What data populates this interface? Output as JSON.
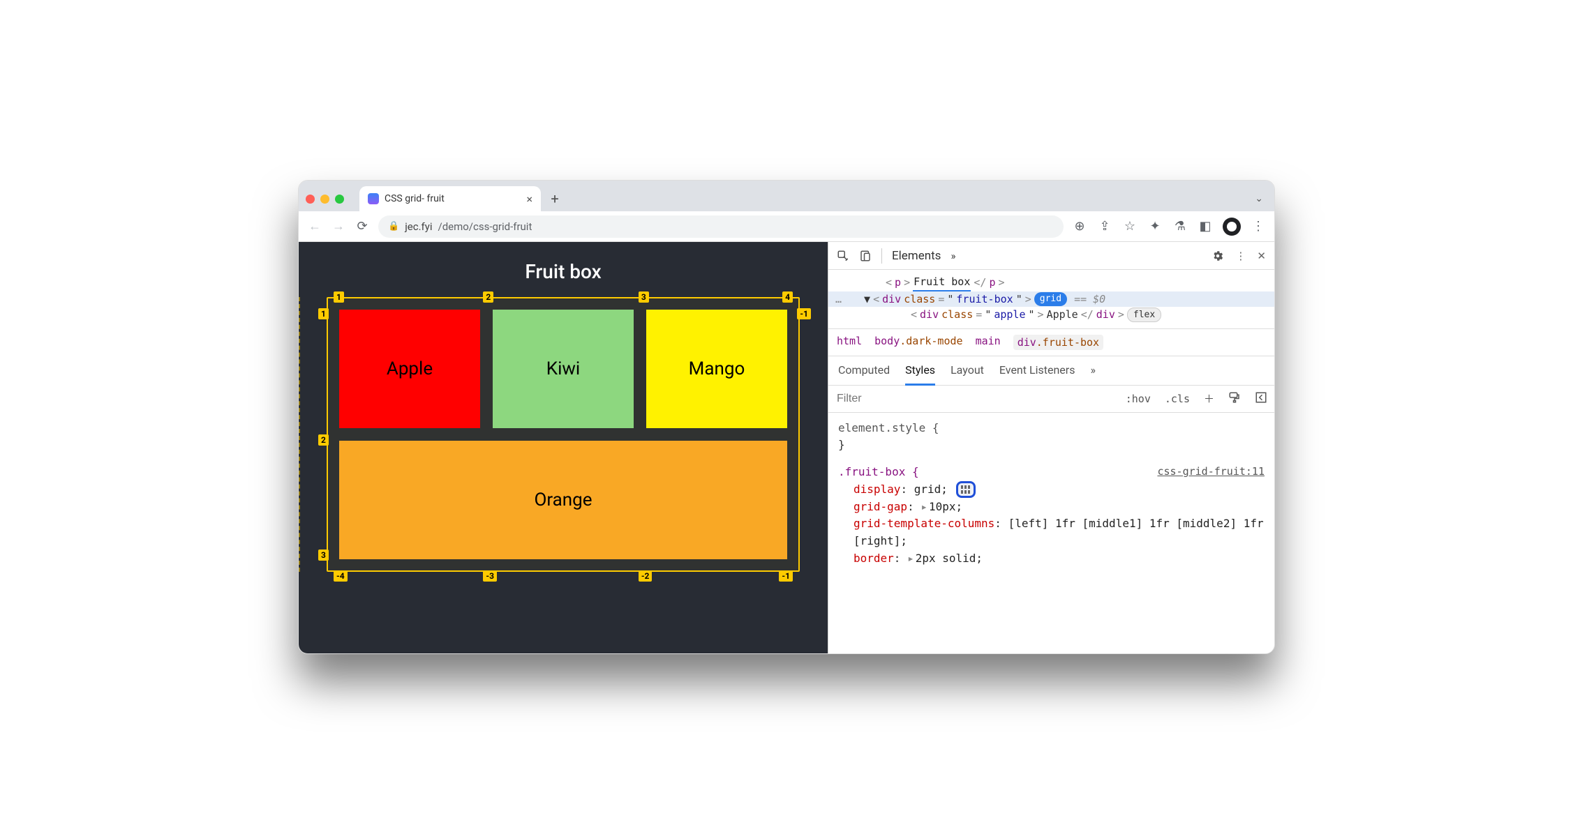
{
  "browser": {
    "tab_title": "CSS grid- fruit",
    "url_host": "jec.fyi",
    "url_path": "/demo/css-grid-fruit"
  },
  "page": {
    "title": "Fruit box",
    "fruits": {
      "apple": "Apple",
      "kiwi": "Kiwi",
      "mango": "Mango",
      "orange": "Orange"
    },
    "col_labels_top": [
      "1",
      "2",
      "3",
      "4"
    ],
    "row_labels_left": [
      "1",
      "2",
      "3"
    ],
    "neg_label_right": "-1",
    "neg_labels_bottom": [
      "-4",
      "-3",
      "-2",
      "-1"
    ]
  },
  "devtools": {
    "panel": "Elements",
    "dom": {
      "p_text": "Fruit box",
      "div_class": "fruit-box",
      "grid_badge": "grid",
      "selected_suffix": "== $0",
      "child_class": "apple",
      "child_text": "Apple",
      "flex_badge": "flex"
    },
    "crumbs": [
      "html",
      "body",
      ".dark-mode",
      "main",
      "div",
      ".fruit-box"
    ],
    "subtabs": [
      "Computed",
      "Styles",
      "Layout",
      "Event Listeners"
    ],
    "filter_placeholder": "Filter",
    "filter_btns": [
      ":hov",
      ".cls"
    ],
    "styles": {
      "element_style": "element.style {",
      "fruitbox_sel": ".fruit-box {",
      "src": "css-grid-fruit:11",
      "decl_display": {
        "prop": "display",
        "val": "grid;"
      },
      "decl_gap": {
        "prop": "grid-gap",
        "val": "10px;"
      },
      "decl_cols": {
        "prop": "grid-template-columns",
        "val": "[left] 1fr [middle1] 1fr [middle2] 1fr [right];"
      },
      "decl_border": {
        "prop": "border",
        "val": "2px solid;"
      }
    }
  }
}
